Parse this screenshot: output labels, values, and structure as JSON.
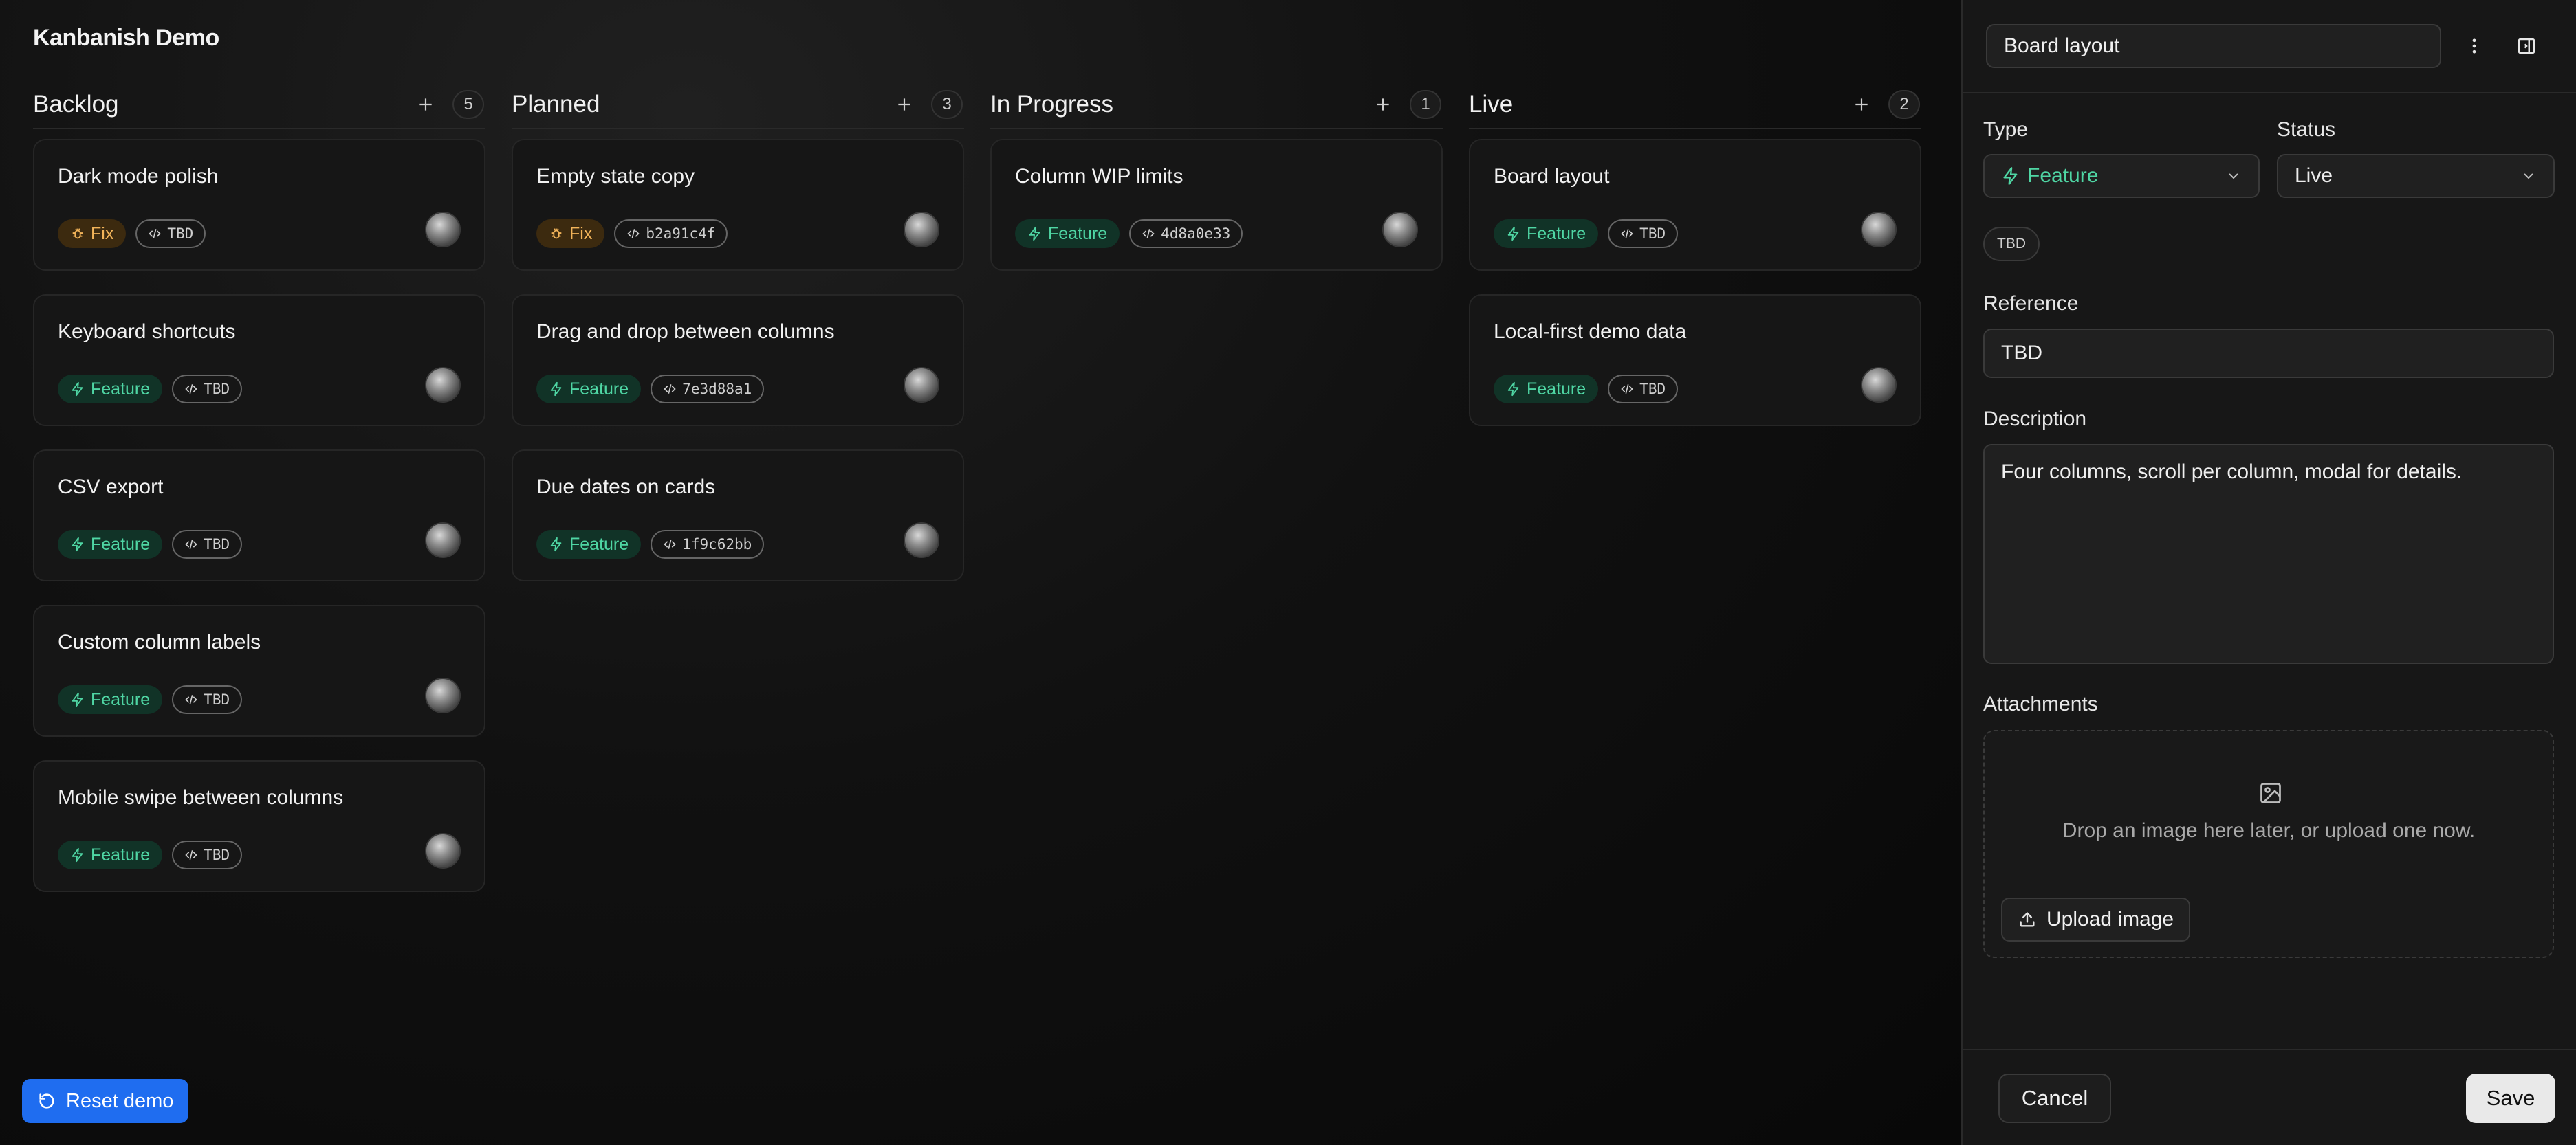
{
  "app": {
    "title": "Kanbanish Demo",
    "reset_label": "Reset demo"
  },
  "columns": [
    {
      "title": "Backlog",
      "count": "5",
      "cards": [
        {
          "title": "Dark mode polish",
          "type": "Fix",
          "ref": "TBD"
        },
        {
          "title": "Keyboard shortcuts",
          "type": "Feature",
          "ref": "TBD"
        },
        {
          "title": "CSV export",
          "type": "Feature",
          "ref": "TBD"
        },
        {
          "title": "Custom column labels",
          "type": "Feature",
          "ref": "TBD"
        },
        {
          "title": "Mobile swipe between columns",
          "type": "Feature",
          "ref": "TBD"
        }
      ]
    },
    {
      "title": "Planned",
      "count": "3",
      "cards": [
        {
          "title": "Empty state copy",
          "type": "Fix",
          "ref": "b2a91c4f"
        },
        {
          "title": "Drag and drop between columns",
          "type": "Feature",
          "ref": "7e3d88a1"
        },
        {
          "title": "Due dates on cards",
          "type": "Feature",
          "ref": "1f9c62bb"
        }
      ]
    },
    {
      "title": "In Progress",
      "count": "1",
      "cards": [
        {
          "title": "Column WIP limits",
          "type": "Feature",
          "ref": "4d8a0e33"
        }
      ]
    },
    {
      "title": "Live",
      "count": "2",
      "cards": [
        {
          "title": "Board layout",
          "type": "Feature",
          "ref": "TBD"
        },
        {
          "title": "Local-first demo data",
          "type": "Feature",
          "ref": "TBD"
        }
      ]
    }
  ],
  "panel": {
    "title_value": "Board layout",
    "type_label": "Type",
    "type_value": "Feature",
    "status_label": "Status",
    "status_value": "Live",
    "ref_chip": "TBD",
    "reference_label": "Reference",
    "reference_value": "TBD",
    "description_label": "Description",
    "description_value": "Four columns, scroll per column, modal for details.",
    "attachments_label": "Attachments",
    "dropzone_text": "Drop an image here later, or upload one now.",
    "upload_label": "Upload image",
    "cancel_label": "Cancel",
    "save_label": "Save"
  },
  "colors": {
    "accent_blue": "#1f6df0",
    "feature_green": "#4fd6a4",
    "fix_amber": "#f2b45a"
  }
}
